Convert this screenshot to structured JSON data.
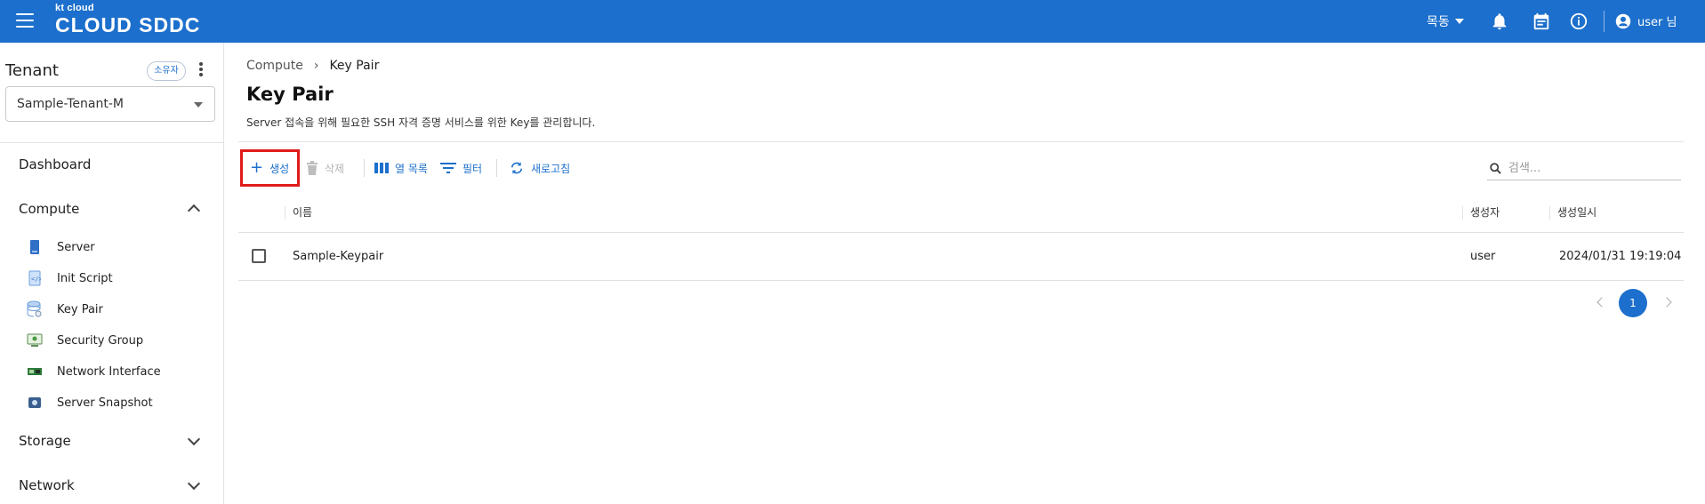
{
  "header": {
    "logo_small": "kt cloud",
    "logo_big": "CLOUD SDDC",
    "region": "목동",
    "user_label": "user 님",
    "icons": [
      "menu-icon",
      "bell-icon",
      "calendar-icon",
      "info-icon",
      "account-icon"
    ]
  },
  "sidebar": {
    "tenant_title": "Tenant",
    "owner_badge": "소유자",
    "tenant_selected": "Sample-Tenant-M",
    "dashboard": "Dashboard",
    "compute": "Compute",
    "compute_items": [
      {
        "label": "Server",
        "icon": "server-icon"
      },
      {
        "label": "Init Script",
        "icon": "script-icon"
      },
      {
        "label": "Key Pair",
        "icon": "key-pair-icon"
      },
      {
        "label": "Security Group",
        "icon": "security-group-icon"
      },
      {
        "label": "Network Interface",
        "icon": "network-interface-icon"
      },
      {
        "label": "Server Snapshot",
        "icon": "snapshot-icon"
      }
    ],
    "storage": "Storage",
    "network": "Network"
  },
  "main": {
    "breadcrumb": [
      "Compute",
      "Key Pair"
    ],
    "title": "Key Pair",
    "description": "Server 접속을 위해 필요한 SSH 자격 증명 서비스를 위한 Key를 관리합니다.",
    "toolbar": {
      "create": "생성",
      "delete": "삭제",
      "columns": "열 목록",
      "filter": "필터",
      "refresh": "새로고침"
    },
    "search_placeholder": "검색...",
    "table": {
      "headers": [
        "이름",
        "생성자",
        "생성일시"
      ],
      "rows": [
        {
          "name": "Sample-Keypair",
          "creator": "user",
          "created": "2024/01/31 19:19:04"
        }
      ]
    },
    "pagination": {
      "current": "1"
    }
  },
  "colors": {
    "primary": "#1c6fcc",
    "highlight": "#e01b1b"
  }
}
